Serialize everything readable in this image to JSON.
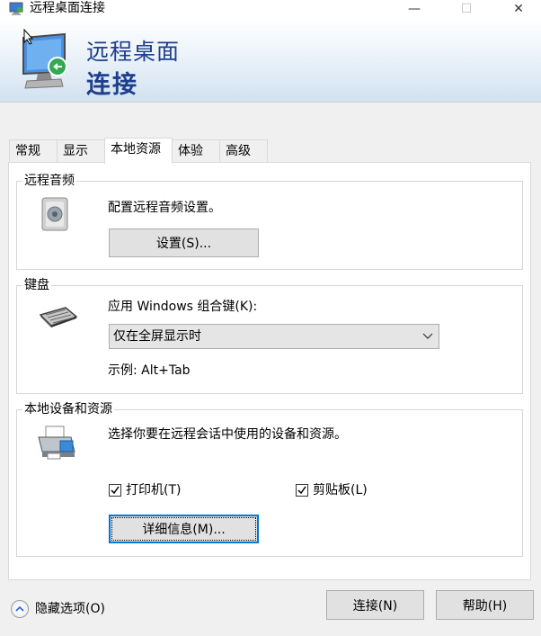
{
  "window": {
    "title": "远程桌面连接",
    "minimize_glyph": "—",
    "maximize_glyph": "☐",
    "close_glyph": "✕"
  },
  "banner": {
    "line1": "远程桌面",
    "line2": "连接"
  },
  "tabs": [
    {
      "label": "常规"
    },
    {
      "label": "显示"
    },
    {
      "label": "本地资源"
    },
    {
      "label": "体验"
    },
    {
      "label": "高级"
    }
  ],
  "active_tab": "本地资源",
  "remote_audio": {
    "legend": "远程音频",
    "description": "配置远程音频设置。",
    "settings_button": "设置(S)..."
  },
  "keyboard": {
    "legend": "键盘",
    "apply_label": "应用 Windows 组合键(K):",
    "selected_option": "仅在全屏显示时",
    "example": "示例: Alt+Tab"
  },
  "local_devices": {
    "legend": "本地设备和资源",
    "description": "选择你要在远程会话中使用的设备和资源。",
    "printer_label": "打印机(T)",
    "printer_checked": true,
    "clipboard_label": "剪贴板(L)",
    "clipboard_checked": true,
    "details_button": "详细信息(M)..."
  },
  "footer": {
    "hide_options": "隐藏选项(O)",
    "connect_button": "连接(N)",
    "help_button": "帮助(H)"
  },
  "colors": {
    "banner_text": "#1e3f8c",
    "focus_border": "#0078d7"
  }
}
